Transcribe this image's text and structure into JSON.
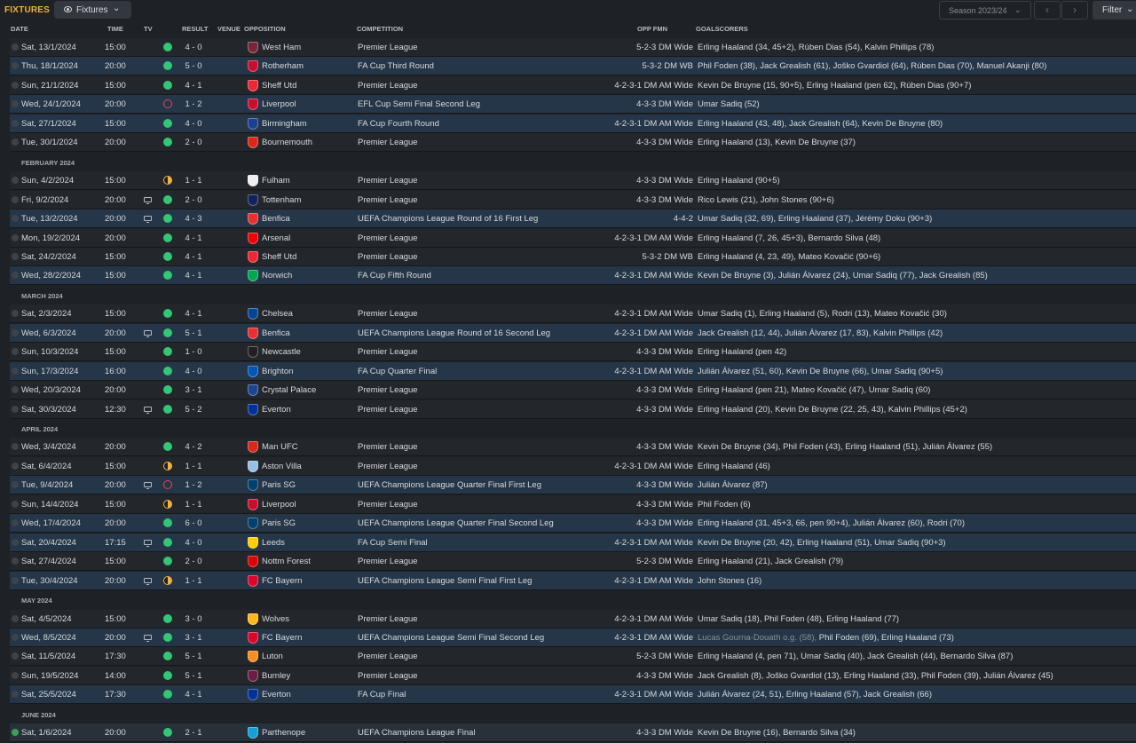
{
  "header": {
    "title": "FIXTURES",
    "view_dropdown": "Fixtures",
    "season": "Season 2023/24",
    "filter": "Filter"
  },
  "columns": {
    "date": "DATE",
    "time": "TIME",
    "tv": "TV",
    "result": "RESULT",
    "venue": "VENUE",
    "opposition": "OPPOSITION",
    "competition": "COMPETITION",
    "opp_fmn": "OPP FMN",
    "goalscorers": "GOALSCORERS"
  },
  "colors": {
    "win": "#33c677",
    "loss": "#e0485a",
    "draw": "#f2b13c",
    "accent": "#f2b13c",
    "highlight_row": "#253648"
  },
  "rows": [
    {
      "type": "match",
      "date": "Sat, 13/1/2024",
      "time": "15:00",
      "tv": false,
      "outcome": "win",
      "score": "4 - 0",
      "venue": "H",
      "opposition": "West Ham",
      "badge_color": "#7a263a",
      "competition": "Premier League",
      "fmn": "5-2-3 DM Wide",
      "scorers": "Erling Haaland (34, 45+2), Rúben Dias (54), Kalvin Phillips (78)",
      "hl": false
    },
    {
      "type": "match",
      "date": "Thu, 18/1/2024",
      "time": "20:00",
      "tv": false,
      "outcome": "win",
      "score": "5 - 0",
      "venue": "H",
      "opposition": "Rotherham",
      "badge_color": "#c8102e",
      "competition": "FA Cup Third Round",
      "fmn": "5-3-2 DM WB",
      "scorers": "Phil Foden (38), Jack Grealish (61), Joško Gvardiol (64), Rúben Dias (70), Manuel Akanji (80)",
      "hl": true
    },
    {
      "type": "match",
      "date": "Sun, 21/1/2024",
      "time": "15:00",
      "tv": false,
      "outcome": "win",
      "score": "4 - 1",
      "venue": "A",
      "opposition": "Sheff Utd",
      "badge_color": "#ee2737",
      "competition": "Premier League",
      "fmn": "4-2-3-1 DM AM Wide",
      "scorers": "Kevin De Bruyne (15, 90+5), Erling Haaland (pen 62), Rúben Dias (90+7)",
      "hl": false
    },
    {
      "type": "match",
      "date": "Wed, 24/1/2024",
      "time": "20:00",
      "tv": false,
      "outcome": "loss",
      "score": "1 - 2",
      "venue": "H",
      "opposition": "Liverpool",
      "badge_color": "#c8102e",
      "competition": "EFL Cup Semi Final Second Leg",
      "fmn": "4-3-3 DM Wide",
      "scorers": "Umar Sadiq (52)",
      "hl": true
    },
    {
      "type": "match",
      "date": "Sat, 27/1/2024",
      "time": "15:00",
      "tv": false,
      "outcome": "win",
      "score": "4 - 0",
      "venue": "H",
      "opposition": "Birmingham",
      "badge_color": "#1c3f94",
      "competition": "FA Cup Fourth Round",
      "fmn": "4-2-3-1 DM AM Wide",
      "scorers": "Erling Haaland (43, 48), Jack Grealish (64), Kevin De Bruyne (80)",
      "hl": true
    },
    {
      "type": "match",
      "date": "Tue, 30/1/2024",
      "time": "20:00",
      "tv": false,
      "outcome": "win",
      "score": "2 - 0",
      "venue": "A",
      "opposition": "Bournemouth",
      "badge_color": "#da291c",
      "competition": "Premier League",
      "fmn": "4-3-3 DM Wide",
      "scorers": "Erling Haaland (13), Kevin De Bruyne (37)",
      "hl": false
    },
    {
      "type": "month",
      "label": "FEBRUARY 2024"
    },
    {
      "type": "match",
      "date": "Sun, 4/2/2024",
      "time": "15:00",
      "tv": false,
      "outcome": "draw",
      "score": "1 - 1",
      "venue": "H",
      "opposition": "Fulham",
      "badge_color": "#eeeeee",
      "competition": "Premier League",
      "fmn": "4-3-3 DM Wide",
      "scorers": "Erling Haaland (90+5)",
      "hl": false
    },
    {
      "type": "match",
      "date": "Fri, 9/2/2024",
      "time": "20:00",
      "tv": true,
      "outcome": "win",
      "score": "2 - 0",
      "venue": "A",
      "opposition": "Tottenham",
      "badge_color": "#132257",
      "competition": "Premier League",
      "fmn": "4-3-3 DM Wide",
      "scorers": "Rico Lewis (21), John Stones (90+6)",
      "hl": false
    },
    {
      "type": "match",
      "date": "Tue, 13/2/2024",
      "time": "20:00",
      "tv": true,
      "outcome": "win",
      "score": "4 - 3",
      "venue": "A",
      "opposition": "Benfica",
      "badge_color": "#e83030",
      "competition": "UEFA Champions League Round of 16 First Leg",
      "fmn": "4-4-2",
      "scorers": "Umar Sadiq (32, 69), Erling Haaland (37), Jérémy Doku (90+3)",
      "hl": true
    },
    {
      "type": "match",
      "date": "Mon, 19/2/2024",
      "time": "20:00",
      "tv": false,
      "outcome": "win",
      "score": "4 - 1",
      "venue": "H",
      "opposition": "Arsenal",
      "badge_color": "#ef0107",
      "competition": "Premier League",
      "fmn": "4-2-3-1 DM AM Wide",
      "scorers": "Erling Haaland (7, 26, 45+3), Bernardo Silva (48)",
      "hl": false
    },
    {
      "type": "match",
      "date": "Sat, 24/2/2024",
      "time": "15:00",
      "tv": false,
      "outcome": "win",
      "score": "4 - 1",
      "venue": "H",
      "opposition": "Sheff Utd",
      "badge_color": "#ee2737",
      "competition": "Premier League",
      "fmn": "5-3-2 DM WB",
      "scorers": "Erling Haaland (4, 23, 49), Mateo Kovačić (90+6)",
      "hl": false
    },
    {
      "type": "match",
      "date": "Wed, 28/2/2024",
      "time": "15:00",
      "tv": false,
      "outcome": "win",
      "score": "4 - 1",
      "venue": "A",
      "opposition": "Norwich",
      "badge_color": "#00a650",
      "competition": "FA Cup Fifth Round",
      "fmn": "4-2-3-1 DM AM Wide",
      "scorers": "Kevin De Bruyne (3), Julián Álvarez (24), Umar Sadiq (77), Jack Grealish (85)",
      "hl": true
    },
    {
      "type": "month",
      "label": "MARCH 2024"
    },
    {
      "type": "match",
      "date": "Sat, 2/3/2024",
      "time": "15:00",
      "tv": false,
      "outcome": "win",
      "score": "4 - 1",
      "venue": "A",
      "opposition": "Chelsea",
      "badge_color": "#034694",
      "competition": "Premier League",
      "fmn": "4-2-3-1 DM AM Wide",
      "scorers": "Umar Sadiq (1), Erling Haaland (5), Rodri (13), Mateo Kovačić (30)",
      "hl": false
    },
    {
      "type": "match",
      "date": "Wed, 6/3/2024",
      "time": "20:00",
      "tv": true,
      "outcome": "win",
      "score": "5 - 1",
      "venue": "H",
      "opposition": "Benfica",
      "badge_color": "#e83030",
      "competition": "UEFA Champions League Round of 16 Second Leg",
      "fmn": "4-2-3-1 DM AM Wide",
      "scorers": "Jack Grealish (12, 44), Julián Álvarez (17, 83), Kalvin Phillips (42)",
      "hl": true
    },
    {
      "type": "match",
      "date": "Sun, 10/3/2024",
      "time": "15:00",
      "tv": false,
      "outcome": "win",
      "score": "1 - 0",
      "venue": "H",
      "opposition": "Newcastle",
      "badge_color": "#241f20",
      "competition": "Premier League",
      "fmn": "4-3-3 DM Wide",
      "scorers": "Erling Haaland (pen 42)",
      "hl": false
    },
    {
      "type": "match",
      "date": "Sun, 17/3/2024",
      "time": "16:00",
      "tv": false,
      "outcome": "win",
      "score": "4 - 0",
      "venue": "H",
      "opposition": "Brighton",
      "badge_color": "#0057b8",
      "competition": "FA Cup Quarter Final",
      "fmn": "4-2-3-1 DM AM Wide",
      "scorers": "Julián Álvarez (51, 60), Kevin De Bruyne (66), Umar Sadiq (90+5)",
      "hl": true
    },
    {
      "type": "match",
      "date": "Wed, 20/3/2024",
      "time": "20:00",
      "tv": false,
      "outcome": "win",
      "score": "3 - 1",
      "venue": "A",
      "opposition": "Crystal Palace",
      "badge_color": "#1b458f",
      "competition": "Premier League",
      "fmn": "4-3-3 DM Wide",
      "scorers": "Erling Haaland (pen 21), Mateo Kovačić (47), Umar Sadiq (60)",
      "hl": false
    },
    {
      "type": "match",
      "date": "Sat, 30/3/2024",
      "time": "12:30",
      "tv": true,
      "outcome": "win",
      "score": "5 - 2",
      "venue": "H",
      "opposition": "Everton",
      "badge_color": "#003399",
      "competition": "Premier League",
      "fmn": "4-3-3 DM Wide",
      "scorers": "Erling Haaland (20), Kevin De Bruyne (22, 25, 43), Kalvin Phillips (45+2)",
      "hl": false
    },
    {
      "type": "month",
      "label": "APRIL 2024"
    },
    {
      "type": "match",
      "date": "Wed, 3/4/2024",
      "time": "20:00",
      "tv": false,
      "outcome": "win",
      "score": "4 - 2",
      "venue": "A",
      "opposition": "Man UFC",
      "badge_color": "#da291c",
      "competition": "Premier League",
      "fmn": "4-3-3 DM Wide",
      "scorers": "Kevin De Bruyne (34), Phil Foden (43), Erling Haaland (51), Julián Álvarez (55)",
      "hl": false
    },
    {
      "type": "match",
      "date": "Sat, 6/4/2024",
      "time": "15:00",
      "tv": false,
      "outcome": "draw",
      "score": "1 - 1",
      "venue": "A",
      "opposition": "Aston Villa",
      "badge_color": "#95bfe5",
      "competition": "Premier League",
      "fmn": "4-2-3-1 DM AM Wide",
      "scorers": "Erling Haaland (46)",
      "hl": false
    },
    {
      "type": "match",
      "date": "Tue, 9/4/2024",
      "time": "20:00",
      "tv": true,
      "outcome": "loss",
      "score": "1 - 2",
      "venue": "A",
      "opposition": "Paris SG",
      "badge_color": "#004170",
      "competition": "UEFA Champions League Quarter Final First Leg",
      "fmn": "4-3-3 DM Wide",
      "scorers": "Julián Álvarez (87)",
      "hl": true
    },
    {
      "type": "match",
      "date": "Sun, 14/4/2024",
      "time": "15:00",
      "tv": false,
      "outcome": "draw",
      "score": "1 - 1",
      "venue": "H",
      "opposition": "Liverpool",
      "badge_color": "#c8102e",
      "competition": "Premier League",
      "fmn": "4-3-3 DM Wide",
      "scorers": "Phil Foden (6)",
      "hl": false
    },
    {
      "type": "match",
      "date": "Wed, 17/4/2024",
      "time": "20:00",
      "tv": false,
      "outcome": "win",
      "score": "6 - 0",
      "venue": "H",
      "opposition": "Paris SG",
      "badge_color": "#004170",
      "competition": "UEFA Champions League Quarter Final Second Leg",
      "fmn": "4-3-3 DM Wide",
      "scorers": "Erling Haaland (31, 45+3, 66, pen 90+4), Julián Álvarez (60), Rodri (70)",
      "hl": true
    },
    {
      "type": "match",
      "date": "Sat, 20/4/2024",
      "time": "17:15",
      "tv": true,
      "outcome": "win",
      "score": "4 - 0",
      "venue": "N",
      "opposition": "Leeds",
      "badge_color": "#ffcd00",
      "competition": "FA Cup Semi Final",
      "fmn": "4-2-3-1 DM AM Wide",
      "scorers": "Kevin De Bruyne (20, 42), Erling Haaland (51), Umar Sadiq (90+3)",
      "hl": true
    },
    {
      "type": "match",
      "date": "Sat, 27/4/2024",
      "time": "15:00",
      "tv": false,
      "outcome": "win",
      "score": "2 - 0",
      "venue": "H",
      "opposition": "Nottm Forest",
      "badge_color": "#dd0000",
      "competition": "Premier League",
      "fmn": "5-2-3 DM Wide",
      "scorers": "Erling Haaland (21), Jack Grealish (79)",
      "hl": false
    },
    {
      "type": "match",
      "date": "Tue, 30/4/2024",
      "time": "20:00",
      "tv": true,
      "outcome": "draw",
      "score": "1 - 1",
      "venue": "A",
      "opposition": "FC Bayern",
      "badge_color": "#dc052d",
      "competition": "UEFA Champions League Semi Final First Leg",
      "fmn": "4-2-3-1 DM AM Wide",
      "scorers": "John Stones (16)",
      "hl": true
    },
    {
      "type": "month",
      "label": "MAY 2024"
    },
    {
      "type": "match",
      "date": "Sat, 4/5/2024",
      "time": "15:00",
      "tv": false,
      "outcome": "win",
      "score": "3 - 0",
      "venue": "A",
      "opposition": "Wolves",
      "badge_color": "#fdb913",
      "competition": "Premier League",
      "fmn": "4-2-3-1 DM AM Wide",
      "scorers": "Umar Sadiq (18), Phil Foden (48), Erling Haaland (77)",
      "hl": false
    },
    {
      "type": "match",
      "date": "Wed, 8/5/2024",
      "time": "20:00",
      "tv": true,
      "outcome": "win",
      "score": "3 - 1",
      "venue": "H",
      "opposition": "FC Bayern",
      "badge_color": "#dc052d",
      "competition": "UEFA Champions League Semi Final Second Leg",
      "fmn": "4-2-3-1 DM AM Wide",
      "og": "Lucas Gourna-Douath o.g. (58), ",
      "scorers": "Phil Foden (69), Erling Haaland (73)",
      "hl": true
    },
    {
      "type": "match",
      "date": "Sat, 11/5/2024",
      "time": "17:30",
      "tv": false,
      "outcome": "win",
      "score": "5 - 1",
      "venue": "H",
      "opposition": "Luton",
      "badge_color": "#f78f1e",
      "competition": "Premier League",
      "fmn": "5-2-3 DM Wide",
      "scorers": "Erling Haaland (4, pen 71), Umar Sadiq (40), Jack Grealish (44), Bernardo Silva (87)",
      "hl": false
    },
    {
      "type": "match",
      "date": "Sun, 19/5/2024",
      "time": "14:00",
      "tv": false,
      "outcome": "win",
      "score": "5 - 1",
      "venue": "A",
      "opposition": "Burnley",
      "badge_color": "#6c1d45",
      "competition": "Premier League",
      "fmn": "4-3-3 DM Wide",
      "scorers": "Jack Grealish (8), Joško Gvardiol (13), Erling Haaland (33), Phil Foden (39), Julián Álvarez (45)",
      "hl": false
    },
    {
      "type": "match",
      "date": "Sat, 25/5/2024",
      "time": "17:30",
      "tv": false,
      "outcome": "win",
      "score": "4 - 1",
      "venue": "N",
      "opposition": "Everton",
      "badge_color": "#003399",
      "competition": "FA Cup Final",
      "fmn": "4-2-3-1 DM AM Wide",
      "scorers": "Julián Álvarez (24, 51), Erling Haaland (57), Jack Grealish (66)",
      "hl": true
    },
    {
      "type": "month",
      "label": "JUNE 2024"
    },
    {
      "type": "match",
      "date": "Sat, 1/6/2024",
      "time": "20:00",
      "tv": false,
      "outcome": "win",
      "score": "2 - 1",
      "venue": "N",
      "opposition": "Parthenope",
      "badge_color": "#12a0d7",
      "competition": "UEFA Champions League Final",
      "fmn": "4-3-3 DM Wide",
      "scorers": "Kevin De Bruyne (16), Bernardo Silva (34)",
      "hl": false,
      "last": true
    }
  ]
}
